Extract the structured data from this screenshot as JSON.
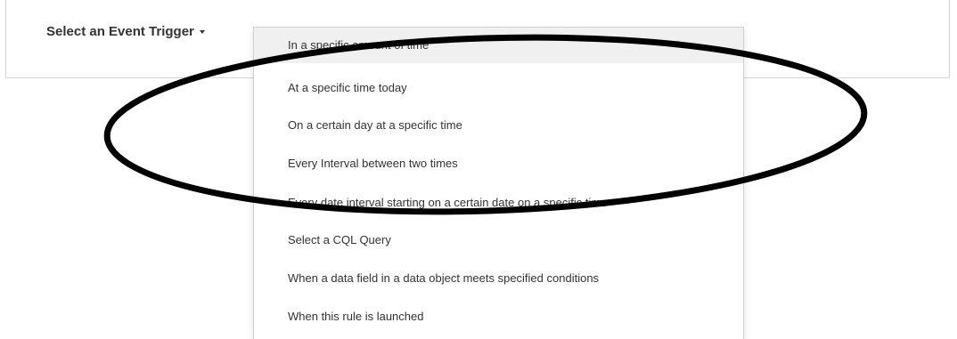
{
  "trigger": {
    "label": "Select an Event Trigger"
  },
  "menu": {
    "items": [
      {
        "label": "In a specific amount of time",
        "active": true
      },
      {
        "label": "At a specific time today",
        "active": false
      },
      {
        "label": "On a certain day at a specific time",
        "active": false
      },
      {
        "label": "Every Interval between two times",
        "active": false
      },
      {
        "label": "Every date interval starting on a certain date on a specific time",
        "active": false
      },
      {
        "label": "Select a CQL Query",
        "active": false
      },
      {
        "label": "When a data field in a data object meets specified conditions",
        "active": false
      },
      {
        "label": "When this rule is launched",
        "active": false
      }
    ]
  },
  "colors": {
    "text": "#333333",
    "active_item_bg": "#f0f0f0",
    "annotation_stroke": "#000000"
  }
}
